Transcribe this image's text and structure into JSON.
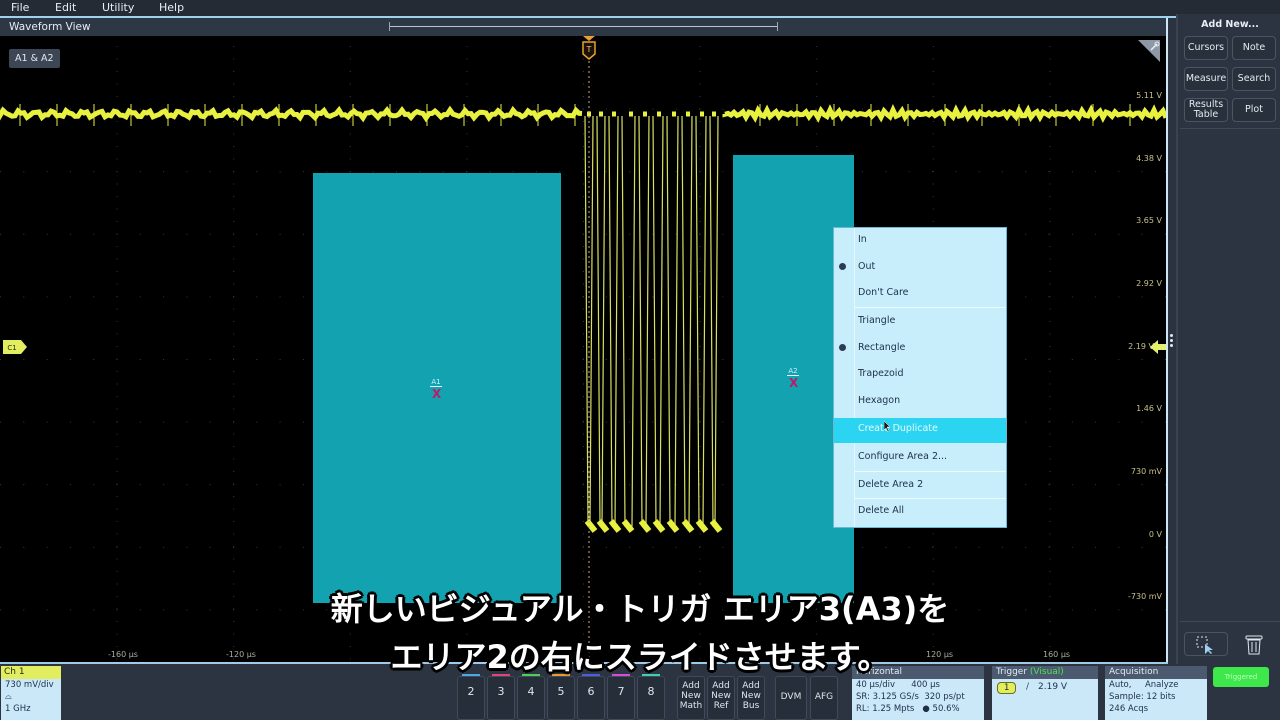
{
  "menu": {
    "items": [
      "File",
      "Edit",
      "Utility",
      "Help"
    ]
  },
  "waveform_view": {
    "title": "Waveform View",
    "area_badge": "A1 & A2",
    "trigger_marker": "T",
    "channel_marker": "C1",
    "y_labels": [
      "5.11 V",
      "4.38 V",
      "3.65 V",
      "2.92 V",
      "2.19 V",
      "1.46 V",
      "730 mV",
      "0 V",
      "-730 mV"
    ],
    "x_labels": [
      "-160 µs",
      "-120 µs",
      "120 µs",
      "160 µs"
    ],
    "areas": [
      {
        "name": "A1",
        "mark": "X"
      },
      {
        "name": "A2",
        "mark": "X"
      }
    ]
  },
  "context_menu": {
    "items": [
      "In",
      "Out",
      "Don't Care",
      "Triangle",
      "Rectangle",
      "Trapezoid",
      "Hexagon",
      "Create Duplicate",
      "Configure Area 2...",
      "Delete Area 2",
      "Delete All"
    ],
    "selected_location": "Out",
    "selected_shape": "Rectangle",
    "highlighted": "Create Duplicate"
  },
  "right_panel": {
    "title": "Add New...",
    "buttons": [
      "Cursors",
      "Note",
      "Measure",
      "Search",
      "Results Table",
      "Plot"
    ]
  },
  "ch1": {
    "title": "Ch 1",
    "scale": "730 mV/div",
    "bandwidth": "1 GHz"
  },
  "channel_buttons": [
    "2",
    "3",
    "4",
    "5",
    "6",
    "7",
    "8"
  ],
  "channel_colors": [
    "#4fa8e6",
    "#e0457a",
    "#4fcf5a",
    "#e89a2e",
    "#4a5ee0",
    "#d04fd8",
    "#3ed0b0"
  ],
  "add_buttons": [
    {
      "l1": "Add",
      "l2": "New",
      "l3": "Math"
    },
    {
      "l1": "Add",
      "l2": "New",
      "l3": "Ref"
    },
    {
      "l1": "Add",
      "l2": "New",
      "l3": "Bus"
    }
  ],
  "tool_buttons": [
    "DVM",
    "AFG"
  ],
  "horizontal": {
    "title": "Horizontal",
    "lines": [
      "40 µs/div      400 µs",
      "SR: 3.125 GS/s  320 ps/pt",
      "RL: 1.25 Mpts   ● 50.6%"
    ]
  },
  "trigger": {
    "title": "Trigger",
    "mode": "(Visual)",
    "source": "1",
    "slope": "/",
    "level": "2.19 V"
  },
  "acquisition": {
    "title": "Acquisition",
    "lines": [
      "Auto,     Analyze",
      "Sample: 12 bits",
      "246 Acqs"
    ]
  },
  "status": {
    "label": "Triggered"
  },
  "subtitles": {
    "line1": "新しいビジュアル・トリガ エリア3(A3)を",
    "line2": "エリア2の右にスライドさせます。"
  }
}
